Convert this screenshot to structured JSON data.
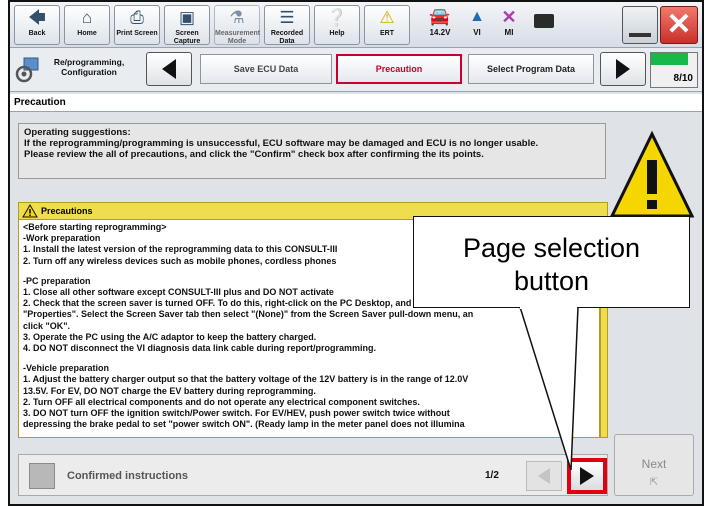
{
  "toolbar": {
    "buttons": [
      {
        "label": "Back",
        "icon": "back-arrow-icon"
      },
      {
        "label": "Home",
        "icon": "home-icon"
      },
      {
        "label": "Print Screen",
        "icon": "printer-icon"
      },
      {
        "label": "Screen Capture",
        "icon": "camera-icon"
      },
      {
        "label": "Measurement Mode",
        "icon": "flask-icon"
      },
      {
        "label": "Recorded Data",
        "icon": "records-icon"
      },
      {
        "label": "Help",
        "icon": "help-icon"
      },
      {
        "label": "ERT",
        "icon": "warning-icon"
      }
    ],
    "status": {
      "battery_voltage": "14.2V",
      "vi_label": "VI",
      "mi_label": "MI"
    }
  },
  "nav": {
    "mode_label": "Re/programming, Configuration",
    "steps": [
      "Save ECU Data",
      "Precaution",
      "Select Program Data"
    ],
    "active_step": "Precaution",
    "progress": "8/10",
    "progress_fraction": 0.8
  },
  "page_title": "Precaution",
  "suggestions": {
    "heading": "Operating suggestions:",
    "line1": "If the reprogramming/programming is unsuccessful, ECU software may be damaged and ECU is no longer usable.",
    "line2": "Please review the all of precautions, and click the \"Confirm\" check box after confirming the its points."
  },
  "precautions": {
    "header": "Precautions",
    "lines": [
      "<Before starting reprogramming>",
      "-Work preparation",
      "1. Install the latest version of the reprogramming data to this CONSULT-III",
      "2. Turn off any wireless devices such as mobile phones, cordless phones",
      "",
      "-PC preparation",
      "1. Close all other software except CONSULT-III plus and DO NOT activate",
      "2. Check that the screen saver is turned OFF. To do this, right-click on the PC Desktop, and select",
      "\"Properties\". Select the Screen Saver tab then select \"(None)\" from the Screen Saver pull-down menu, an",
      "click \"OK\".",
      "3. Operate the PC using the A/C adaptor to keep the battery charged.",
      "4. DO NOT disconnect the VI diagnosis data link cable during report/programming.",
      "",
      "-Vehicle preparation",
      "1. Adjust the battery charger output so that the battery voltage of the 12V battery is in the range of 12.0V",
      "13.5V. For EV, DO NOT charge the EV battery during reprogramming.",
      "2. Turn OFF all electrical components and do not operate any electrical component switches.",
      "3. DO NOT turn OFF the ignition switch/Power switch. For EV/HEV, push power switch twice without",
      "depressing the brake pedal to set \"power switch ON\". (Ready lamp in the meter panel does not illumina"
    ]
  },
  "bottom": {
    "confirmed_label": "Confirmed instructions",
    "page_indicator": "1/2"
  },
  "next_label": "Next",
  "callout": {
    "line1": "Page selection",
    "line2": "button"
  },
  "colors": {
    "precaution_yellow": "#f0dc4f",
    "active_step_red": "#c8002a",
    "highlight_red": "#e00010",
    "progress_green": "#18b84a"
  }
}
